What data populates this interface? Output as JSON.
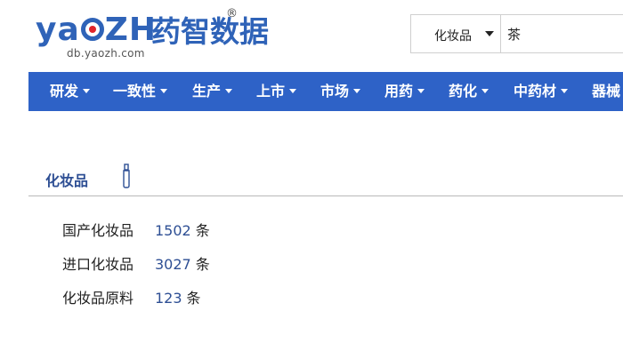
{
  "logo": {
    "wordmark_start": "ya",
    "wordmark_end": "ZH",
    "cn_name": "药智数据",
    "registered": "®",
    "sub_domain": "db.yaozh.com"
  },
  "search": {
    "category": "化妆品",
    "query": "茶"
  },
  "nav": {
    "items": [
      {
        "label": "研发"
      },
      {
        "label": "一致性"
      },
      {
        "label": "生产"
      },
      {
        "label": "上市"
      },
      {
        "label": "市场"
      },
      {
        "label": "用药"
      },
      {
        "label": "药化"
      },
      {
        "label": "中药材"
      },
      {
        "label": "器械"
      }
    ]
  },
  "section": {
    "title": "化妆品",
    "icon": "bottle-icon"
  },
  "stats": [
    {
      "label": "国产化妆品",
      "count": "1502",
      "unit": "条"
    },
    {
      "label": "进口化妆品",
      "count": "3027",
      "unit": "条"
    },
    {
      "label": "化妆品原料",
      "count": "123",
      "unit": "条"
    }
  ],
  "colors": {
    "brand_blue": "#2f63b8",
    "nav_blue": "#2e62c7",
    "link_blue": "#2e4f94",
    "logo_red": "#e0242b"
  }
}
